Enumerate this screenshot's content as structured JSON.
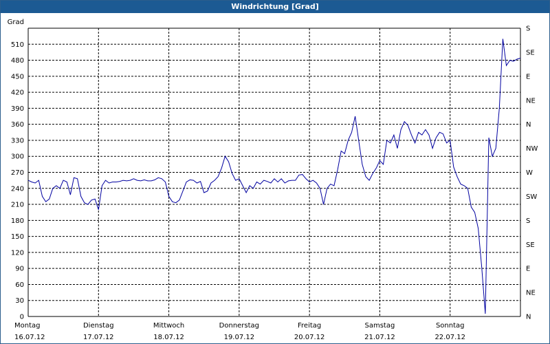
{
  "window": {
    "title": "Windrichtung [Grad]"
  },
  "chart_data": {
    "type": "line",
    "title": "Windrichtung [Grad]",
    "ylabel": "Grad",
    "ylim": [
      0,
      540
    ],
    "xlim": [
      0,
      7
    ],
    "grid": true,
    "y_ticks": [
      0,
      30,
      60,
      90,
      120,
      150,
      180,
      210,
      240,
      270,
      300,
      330,
      360,
      390,
      420,
      450,
      480,
      510
    ],
    "right_ticks": [
      {
        "value": 0,
        "label": "N"
      },
      {
        "value": 45,
        "label": "NE"
      },
      {
        "value": 90,
        "label": "E"
      },
      {
        "value": 135,
        "label": "SE"
      },
      {
        "value": 180,
        "label": "S"
      },
      {
        "value": 225,
        "label": "SW"
      },
      {
        "value": 270,
        "label": "W"
      },
      {
        "value": 315,
        "label": "NW"
      },
      {
        "value": 360,
        "label": "N"
      },
      {
        "value": 405,
        "label": "NE"
      },
      {
        "value": 450,
        "label": "E"
      },
      {
        "value": 495,
        "label": "SE"
      },
      {
        "value": 540,
        "label": "S"
      }
    ],
    "x_ticks": [
      {
        "day": "Montag",
        "date": "16.07.12"
      },
      {
        "day": "Dienstag",
        "date": "17.07.12"
      },
      {
        "day": "Mittwoch",
        "date": "18.07.12"
      },
      {
        "day": "Donnerstag",
        "date": "19.07.12"
      },
      {
        "day": "Freitag",
        "date": "20.07.12"
      },
      {
        "day": "Samstag",
        "date": "21.07.12"
      },
      {
        "day": "Sonntag",
        "date": "22.07.12"
      }
    ],
    "series": [
      {
        "color": "#0000a0",
        "x": [
          0,
          0.05,
          0.1,
          0.15,
          0.2,
          0.25,
          0.3,
          0.35,
          0.4,
          0.45,
          0.5,
          0.55,
          0.6,
          0.65,
          0.7,
          0.75,
          0.8,
          0.85,
          0.9,
          0.95,
          1.0,
          1.05,
          1.1,
          1.15,
          1.2,
          1.25,
          1.3,
          1.35,
          1.4,
          1.45,
          1.5,
          1.55,
          1.6,
          1.65,
          1.7,
          1.75,
          1.8,
          1.85,
          1.9,
          1.95,
          2.0,
          2.05,
          2.1,
          2.15,
          2.2,
          2.25,
          2.3,
          2.35,
          2.4,
          2.45,
          2.5,
          2.55,
          2.6,
          2.65,
          2.7,
          2.75,
          2.8,
          2.85,
          2.9,
          2.95,
          3.0,
          3.05,
          3.1,
          3.15,
          3.2,
          3.25,
          3.3,
          3.35,
          3.4,
          3.45,
          3.5,
          3.55,
          3.6,
          3.65,
          3.7,
          3.75,
          3.8,
          3.85,
          3.9,
          3.95,
          4.0,
          4.05,
          4.1,
          4.15,
          4.2,
          4.25,
          4.3,
          4.35,
          4.4,
          4.45,
          4.5,
          4.55,
          4.6,
          4.65,
          4.7,
          4.75,
          4.8,
          4.85,
          4.9,
          4.95,
          5.0,
          5.05,
          5.1,
          5.15,
          5.2,
          5.25,
          5.3,
          5.35,
          5.4,
          5.45,
          5.5,
          5.55,
          5.6,
          5.65,
          5.7,
          5.75,
          5.8,
          5.85,
          5.9,
          5.95,
          6.0,
          6.05,
          6.1,
          6.15,
          6.2,
          6.25,
          6.3,
          6.35,
          6.4,
          6.45,
          6.5,
          6.55,
          6.6,
          6.65,
          6.7,
          6.75,
          6.8,
          6.85,
          6.9,
          6.95,
          7.0
        ],
        "y": [
          255,
          252,
          250,
          255,
          225,
          215,
          220,
          240,
          245,
          240,
          255,
          252,
          228,
          260,
          258,
          225,
          213,
          210,
          218,
          220,
          200,
          245,
          255,
          250,
          252,
          252,
          253,
          255,
          254,
          255,
          258,
          255,
          254,
          256,
          254,
          254,
          256,
          260,
          258,
          252,
          225,
          215,
          213,
          218,
          235,
          252,
          256,
          255,
          250,
          253,
          232,
          235,
          250,
          255,
          262,
          278,
          300,
          290,
          268,
          255,
          258,
          245,
          232,
          245,
          240,
          252,
          248,
          255,
          253,
          250,
          258,
          252,
          258,
          250,
          254,
          255,
          255,
          265,
          266,
          258,
          252,
          255,
          250,
          240,
          210,
          240,
          248,
          245,
          275,
          310,
          305,
          330,
          345,
          375,
          330,
          285,
          262,
          255,
          268,
          278,
          292,
          285,
          330,
          325,
          340,
          315,
          350,
          365,
          358,
          340,
          325,
          345,
          340,
          350,
          340,
          315,
          335,
          345,
          342,
          325,
          330,
          280,
          262,
          248,
          245,
          240,
          205,
          195,
          165,
          92,
          5,
          335,
          300,
          315,
          390,
          520,
          470,
          480,
          478,
          482,
          484
        ]
      }
    ]
  }
}
